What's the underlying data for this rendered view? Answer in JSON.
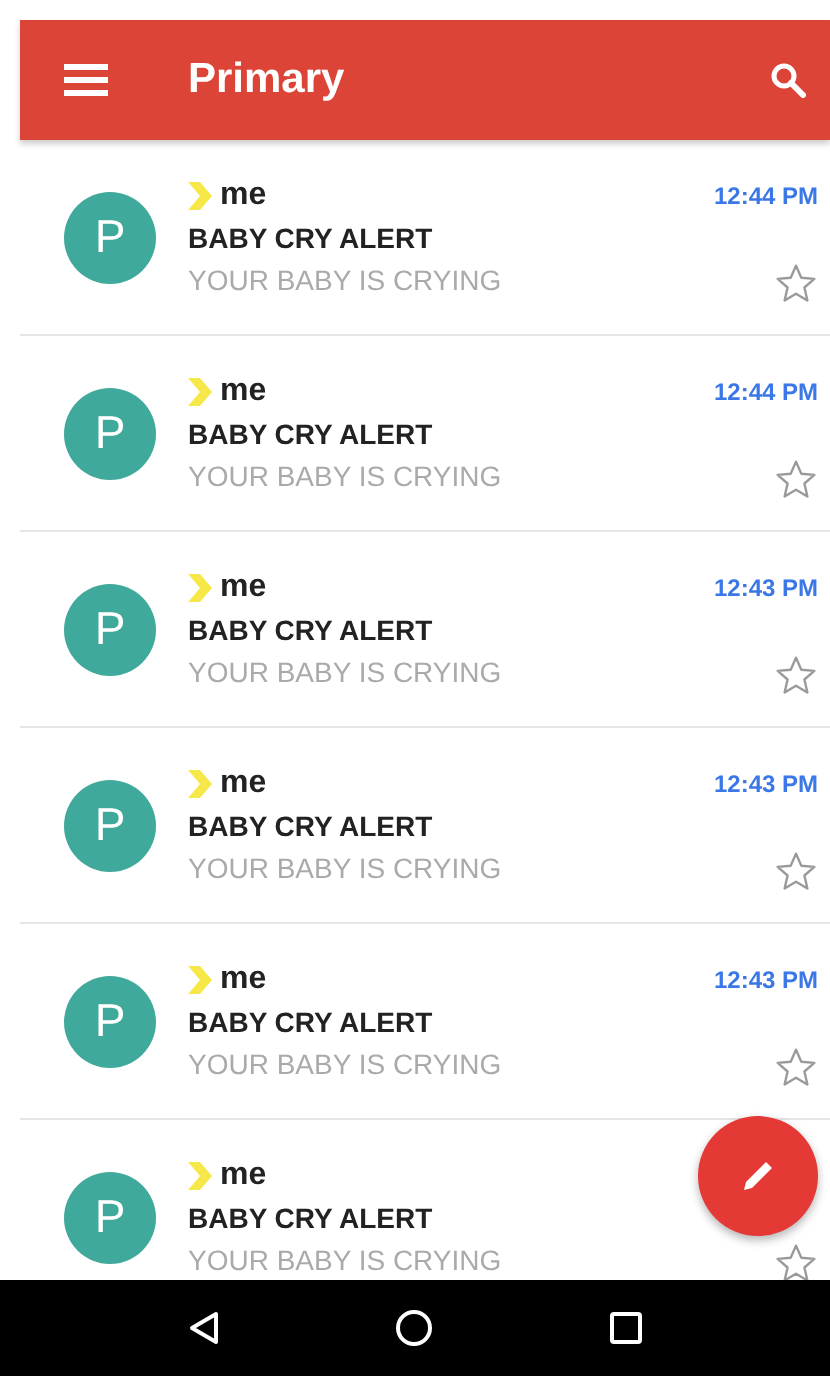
{
  "app_bar": {
    "title": "Primary"
  },
  "messages": [
    {
      "avatar": "P",
      "sender": "me",
      "important": true,
      "subject": "BABY CRY ALERT",
      "snippet": "YOUR BABY IS CRYING",
      "time": "12:44 PM",
      "starred": false
    },
    {
      "avatar": "P",
      "sender": "me",
      "important": true,
      "subject": "BABY CRY ALERT",
      "snippet": "YOUR BABY IS CRYING",
      "time": "12:44 PM",
      "starred": false
    },
    {
      "avatar": "P",
      "sender": "me",
      "important": true,
      "subject": "BABY CRY ALERT",
      "snippet": "YOUR BABY IS CRYING",
      "time": "12:43 PM",
      "starred": false
    },
    {
      "avatar": "P",
      "sender": "me",
      "important": true,
      "subject": "BABY CRY ALERT",
      "snippet": "YOUR BABY IS CRYING",
      "time": "12:43 PM",
      "starred": false
    },
    {
      "avatar": "P",
      "sender": "me",
      "important": true,
      "subject": "BABY CRY ALERT",
      "snippet": "YOUR BABY IS CRYING",
      "time": "12:43 PM",
      "starred": false
    },
    {
      "avatar": "P",
      "sender": "me",
      "important": true,
      "subject": "BABY CRY ALERT",
      "snippet": "YOUR BABY IS CRYING",
      "starred": false
    }
  ]
}
